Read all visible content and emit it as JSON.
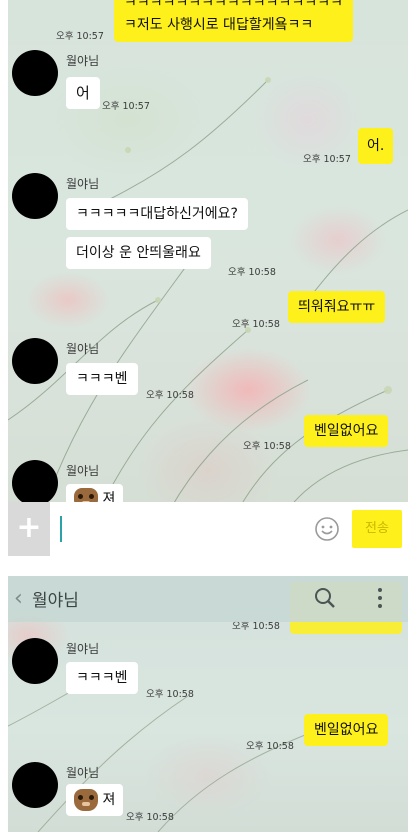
{
  "chat_top": {
    "messages": [
      {
        "type": "outgoing_multi",
        "lines": [
          "ㅋㅋㅋㅋㅋㅋㅋㅋㅋㅋㅋㅋㅋㅋㅋㅋㅋ",
          "ㅋ저도 사행시로 대답할게욬ㅋㅋ"
        ],
        "time": "오후 10:57"
      },
      {
        "type": "incoming",
        "sender": "월야님",
        "text": "어",
        "time": "오후 10:57"
      },
      {
        "type": "outgoing",
        "text": "어.",
        "time": "오후 10:57"
      },
      {
        "type": "incoming",
        "sender": "월야님",
        "text": "ㅋㅋㅋㅋㅋ대답하신거에요?"
      },
      {
        "type": "incoming",
        "text": "더이상 운 안띄울래요",
        "time": "오후 10:58"
      },
      {
        "type": "outgoing",
        "text": "띄워줘요ㅠㅠ",
        "time": "오후 10:58"
      },
      {
        "type": "incoming",
        "sender": "월야님",
        "text": "ㅋㅋㅋ벤",
        "time": "오후 10:58"
      },
      {
        "type": "outgoing",
        "text": "벤일없어요",
        "time": "오후 10:58"
      },
      {
        "type": "incoming",
        "sender": "월야님",
        "text": "져"
      }
    ],
    "input_bar": {
      "plus_label": "+",
      "placeholder": "",
      "send_label": "전송"
    }
  },
  "chat_bottom": {
    "header": {
      "back_label": "‹",
      "title": "월야님"
    },
    "messages": [
      {
        "type": "outgoing",
        "text": "",
        "time": "오후 10:58"
      },
      {
        "type": "incoming",
        "sender": "월야님",
        "text": "ㅋㅋㅋ벤",
        "time": "오후 10:58"
      },
      {
        "type": "outgoing",
        "text": "벤일없어요",
        "time": "오후 10:58"
      },
      {
        "type": "incoming",
        "sender": "월야님",
        "text": "져",
        "time": "오후 10:58"
      }
    ]
  },
  "colors": {
    "bubble_yellow": "#fef01b",
    "bubble_white": "#ffffff",
    "header_bg": "#cfdcd9",
    "input_bar_bg": "#ffffff",
    "send_button": "#fef01b"
  }
}
